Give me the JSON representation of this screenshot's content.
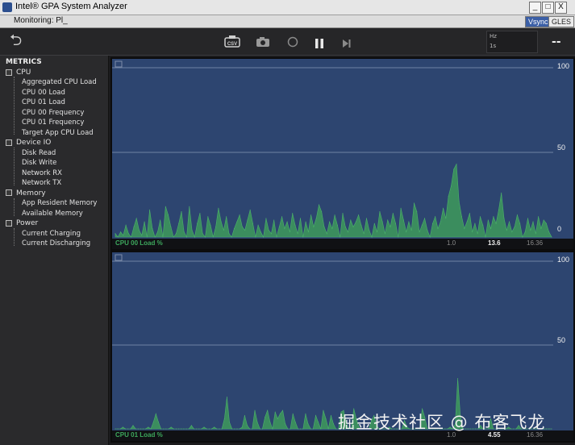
{
  "window": {
    "title": "Intel® GPA System Analyzer",
    "minimize_glyph": "_",
    "maximize_glyph": "□",
    "close_glyph": "X"
  },
  "menubar": {
    "monitoring": "Monitoring: Pl_",
    "vsync": "Vsync",
    "gles": "GLES"
  },
  "toolbar": {
    "back_glyph": "⮌",
    "csv_label": "CSV",
    "hz_label": "Hz",
    "sec_label": "1s",
    "dashes": "--"
  },
  "metrics": {
    "title": "METRICS",
    "groups": [
      {
        "label": "CPU",
        "items": [
          "Aggregated CPU Load",
          "CPU 00 Load",
          "CPU 01 Load",
          "CPU 00 Frequency",
          "CPU 01 Frequency",
          "Target App CPU Load"
        ]
      },
      {
        "label": "Device IO",
        "items": [
          "Disk Read",
          "Disk Write",
          "Network RX",
          "Network TX"
        ]
      },
      {
        "label": "Memory",
        "items": [
          "App Resident Memory",
          "Available Memory"
        ]
      },
      {
        "label": "Power",
        "items": [
          "Current Charging",
          "Current Discharging"
        ]
      }
    ]
  },
  "chart_data": [
    {
      "type": "area",
      "title": "CPU 00 Load %",
      "ylim": [
        0,
        100
      ],
      "yticks": [
        "100",
        "50",
        "0"
      ],
      "grid": true,
      "series_color": "#3e9a5a",
      "status": {
        "name": "CPU 00 Load %",
        "min": "1.0",
        "current": "13.6",
        "max": "16.36"
      },
      "values": [
        2,
        0,
        3,
        1,
        7,
        2,
        0,
        6,
        11,
        4,
        1,
        9,
        0,
        16,
        5,
        0,
        3,
        10,
        0,
        18,
        13,
        6,
        0,
        2,
        8,
        15,
        3,
        0,
        18,
        4,
        0,
        8,
        14,
        2,
        0,
        12,
        7,
        0,
        6,
        17,
        9,
        4,
        12,
        2,
        0,
        5,
        9,
        13,
        6,
        4,
        10,
        16,
        8,
        0,
        7,
        3,
        0,
        11,
        4,
        2,
        10,
        0,
        6,
        12,
        5,
        9,
        3,
        14,
        7,
        2,
        11,
        0,
        9,
        3,
        13,
        6,
        11,
        19,
        15,
        6,
        2,
        9,
        5,
        13,
        7,
        0,
        14,
        6,
        3,
        10,
        6,
        9,
        13,
        7,
        2,
        11,
        4,
        0,
        8,
        3,
        15,
        9,
        2,
        10,
        6,
        14,
        8,
        0,
        17,
        10,
        3,
        9,
        4,
        20,
        15,
        3,
        7,
        11,
        4,
        0,
        8,
        12,
        5,
        9,
        17,
        11,
        24,
        30,
        40,
        43,
        21,
        12,
        5,
        9,
        14,
        3,
        8,
        2,
        12,
        7,
        0,
        10,
        5,
        12,
        8,
        16,
        26,
        11,
        4,
        9,
        3,
        6,
        13,
        8,
        0,
        3,
        11,
        4,
        9,
        2,
        12,
        5,
        10,
        8,
        3,
        0
      ]
    },
    {
      "type": "area",
      "title": "CPU 01 Load %",
      "ylim": [
        0,
        100
      ],
      "yticks": [
        "100",
        "50",
        "0"
      ],
      "grid": true,
      "series_color": "#3e9a5a",
      "status": {
        "name": "CPU 01 Load %",
        "min": "1.0",
        "current": "4.55",
        "max": "16.36"
      },
      "values": [
        0,
        0,
        0,
        1,
        0,
        0,
        0,
        2,
        0,
        0,
        0,
        0,
        0,
        1,
        0,
        4,
        9,
        4,
        0,
        0,
        0,
        0,
        1,
        0,
        0,
        0,
        0,
        0,
        0,
        0,
        2,
        0,
        0,
        0,
        0,
        1,
        0,
        0,
        0,
        1,
        0,
        0,
        0,
        6,
        19,
        4,
        0,
        0,
        0,
        0,
        1,
        8,
        2,
        0,
        0,
        11,
        4,
        0,
        0,
        7,
        11,
        4,
        0,
        10,
        6,
        9,
        11,
        3,
        0,
        0,
        9,
        4,
        0,
        0,
        0,
        9,
        3,
        0,
        0,
        8,
        4,
        0,
        11,
        6,
        0,
        8,
        3,
        0,
        0,
        10,
        11,
        4,
        0,
        0,
        12,
        6,
        1,
        0,
        0,
        0,
        0,
        5,
        8,
        2,
        0,
        0,
        0,
        0,
        1,
        0,
        0,
        0,
        0,
        0,
        5,
        1,
        0,
        0,
        0,
        0,
        0,
        12,
        7,
        0,
        0,
        0,
        0,
        0,
        0,
        0,
        0,
        0,
        1,
        0,
        3,
        30,
        8,
        0,
        0,
        0,
        0,
        0,
        0,
        0,
        2,
        0,
        0,
        0,
        6,
        0,
        0,
        0,
        0,
        0,
        0,
        1,
        0,
        0,
        0,
        2,
        0,
        0,
        0,
        0,
        0,
        0,
        0,
        0,
        0,
        0,
        0,
        0,
        0
      ]
    }
  ],
  "watermark": "掘金技术社区 @ 布客飞龙"
}
